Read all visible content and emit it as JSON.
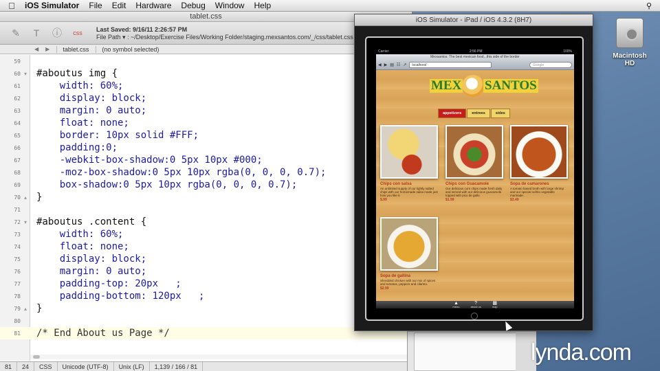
{
  "menubar": {
    "app": "iOS Simulator",
    "items": [
      "File",
      "Edit",
      "Hardware",
      "Debug",
      "Window",
      "Help"
    ]
  },
  "editor": {
    "title": "tablet.css",
    "last_saved": "Last Saved: 9/16/11 2:26:57 PM",
    "file_path": "File Path ▾ : ~/Desktop/Exercise Files/Working Folder/staging.mexsantos.com/_/css/tablet.css",
    "nav_file": "tablet.css",
    "nav_symbol": "(no symbol selected)",
    "lines": [
      {
        "n": "59",
        "text": ""
      },
      {
        "n": "60",
        "text": "#aboutus img {"
      },
      {
        "n": "61",
        "text": "    width: 60%;"
      },
      {
        "n": "62",
        "text": "    display: block;"
      },
      {
        "n": "63",
        "text": "    margin: 0 auto;"
      },
      {
        "n": "64",
        "text": "    float: none;"
      },
      {
        "n": "65",
        "text": "    border: 10px solid #FFF;"
      },
      {
        "n": "66",
        "text": "    padding:0;"
      },
      {
        "n": "67",
        "text": "    -webkit-box-shadow:0 5px 10px #000;"
      },
      {
        "n": "68",
        "text": "    -moz-box-shadow:0 5px 10px rgba(0, 0, 0, 0.7);"
      },
      {
        "n": "69",
        "text": "    box-shadow:0 5px 10px rgba(0, 0, 0, 0.7);"
      },
      {
        "n": "70",
        "text": "}"
      },
      {
        "n": "71",
        "text": ""
      },
      {
        "n": "72",
        "text": "#aboutus .content {"
      },
      {
        "n": "73",
        "text": "    width: 60%;"
      },
      {
        "n": "74",
        "text": "    float: none;"
      },
      {
        "n": "75",
        "text": "    display: block;"
      },
      {
        "n": "76",
        "text": "    margin: 0 auto;"
      },
      {
        "n": "77",
        "text": "    padding-top: 20px   ;"
      },
      {
        "n": "78",
        "text": "    padding-bottom: 120px   ;"
      },
      {
        "n": "79",
        "text": "}"
      },
      {
        "n": "80",
        "text": ""
      },
      {
        "n": "81",
        "text": "/* End About us Page */"
      }
    ],
    "status": [
      "81",
      "24",
      "CSS",
      "Unicode (UTF-8)",
      "Unix (LF)",
      "1,139 / 166 / 81"
    ]
  },
  "simulator": {
    "title": "iOS Simulator - iPad / iOS 4.3.2 (8H7)",
    "carrier": "Carrier",
    "time": "2:56 PM",
    "battery": "100%",
    "page_title": "Mexsantos: The best mexican food...this side of the border",
    "url": "localhost/",
    "search_placeholder": "Google",
    "logo_left": "MEX",
    "logo_right": "SANTOS",
    "tabs": [
      "appetizers",
      "entrees",
      "sides"
    ],
    "items": [
      {
        "title": "Chips con salsa",
        "desc": "An unlimited supply of our lightly salted chips with our homemade salsa made just how you like it.",
        "price": "$.99"
      },
      {
        "title": "Chips con Guacamole",
        "desc": "Our delicious corn chips made fresh daily and served with our delicious guacamole topped with pico de gallo.",
        "price": "$1.99"
      },
      {
        "title": "Sopa de camarones",
        "desc": "A tomato based broth with large shrimp and our special sofrito vegetable marinade.",
        "price": "$3.49"
      },
      {
        "title": "Sopa de gallina",
        "desc": "Shredded chicken with our mix of spices and tomatos, peppers and cilantro.",
        "price": "$2.99"
      }
    ],
    "toolbar": [
      "menu",
      "about us",
      "map"
    ]
  },
  "desktop": {
    "hd_label": "Macintosh HD",
    "watermark": "lynda.com"
  }
}
